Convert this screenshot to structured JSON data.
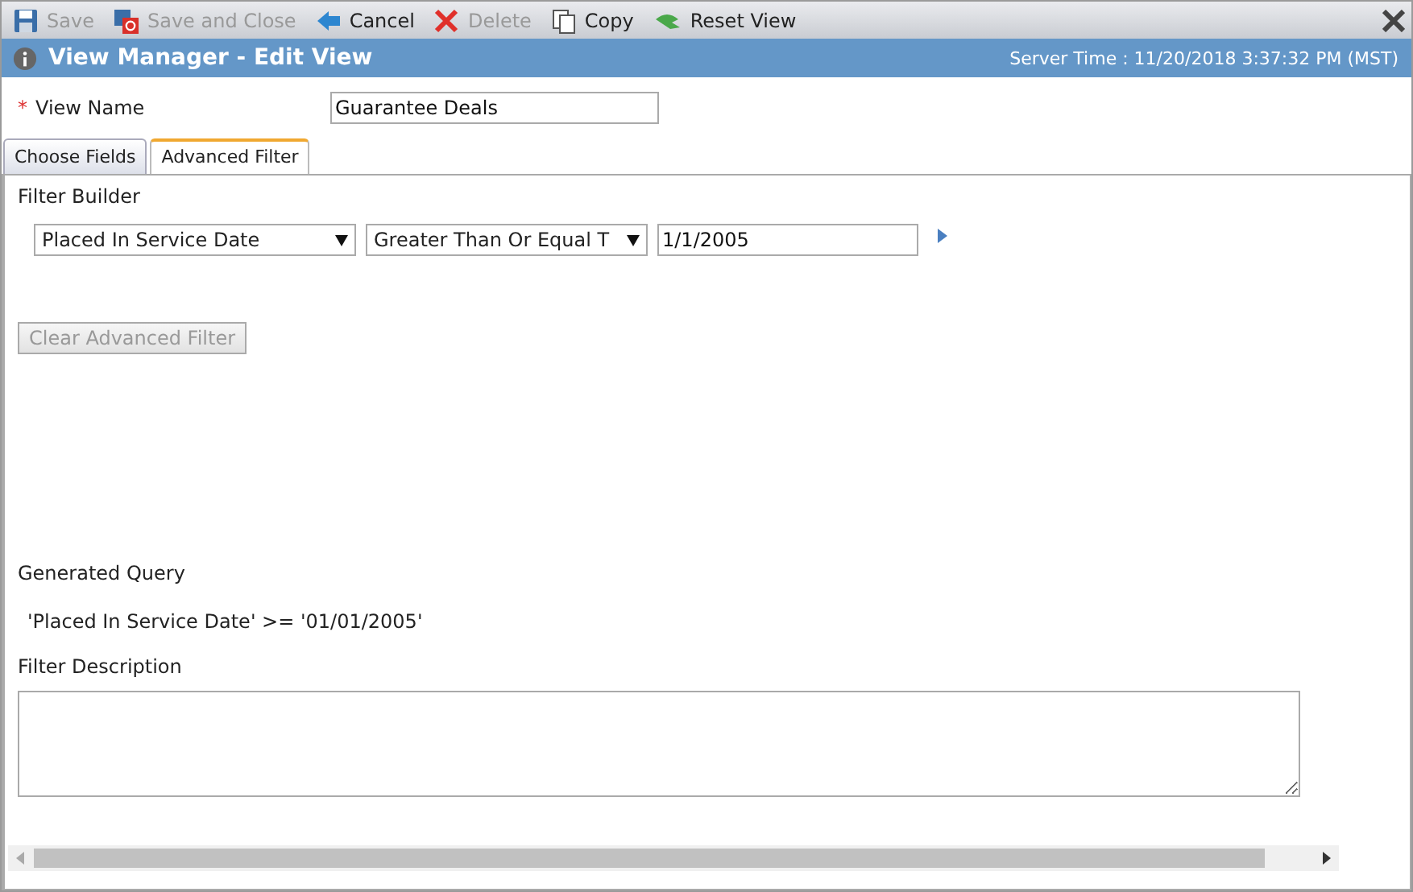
{
  "toolbar": [
    {
      "kind": "save",
      "label": "Save",
      "disabled": true
    },
    {
      "kind": "save-close",
      "label": "Save and Close",
      "disabled": true
    },
    {
      "kind": "cancel",
      "label": "Cancel",
      "disabled": false
    },
    {
      "kind": "delete",
      "label": "Delete",
      "disabled": true
    },
    {
      "kind": "copy",
      "label": "Copy",
      "disabled": false
    },
    {
      "kind": "reset",
      "label": "Reset View",
      "disabled": false
    }
  ],
  "header": {
    "title": "View Manager - Edit View",
    "server_time": "Server Time : 11/20/2018 3:37:32 PM (MST)"
  },
  "view_name": {
    "required_mark": "*",
    "label": "View Name",
    "value": "Guarantee Deals"
  },
  "tabs": [
    {
      "label": "Choose Fields",
      "selected": false
    },
    {
      "label": "Advanced Filter",
      "selected": true
    }
  ],
  "filter_builder": {
    "label": "Filter Builder",
    "field": "Placed In Service Date",
    "operator": "Greater Than Or Equal T",
    "value": "1/1/2005"
  },
  "clear_button": {
    "label": "Clear Advanced Filter",
    "disabled": true
  },
  "generated_query": {
    "label": "Generated Query",
    "text": "'Placed In Service Date' >= '01/01/2005'"
  },
  "filter_description": {
    "label": "Filter Description"
  }
}
